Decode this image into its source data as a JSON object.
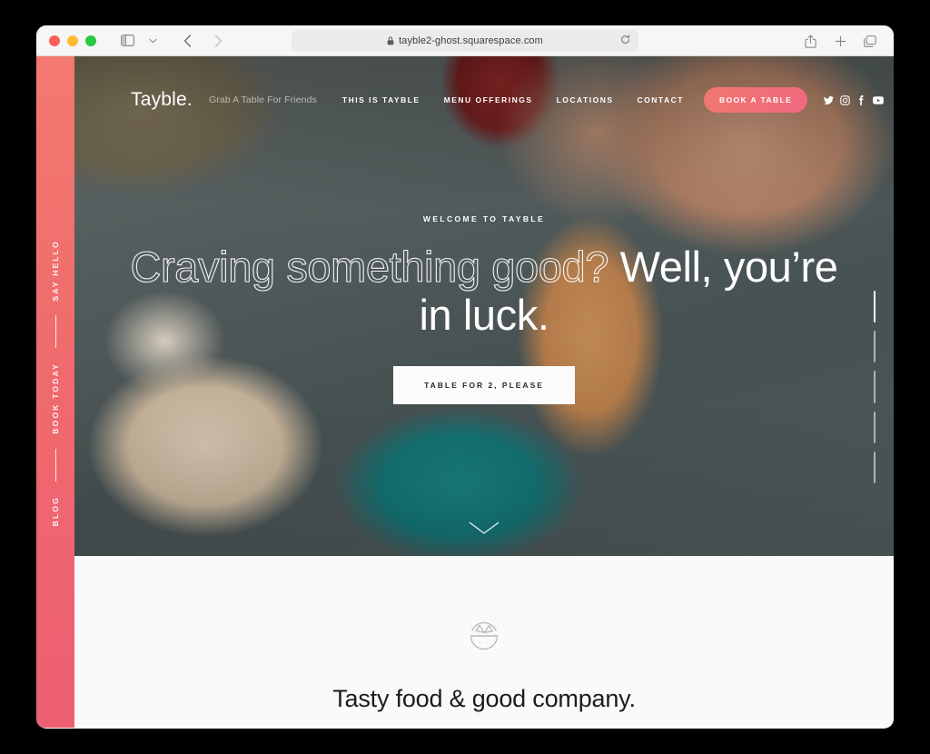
{
  "browser": {
    "traffic_lights": [
      "close",
      "minimize",
      "maximize"
    ],
    "sidebar_toggle_label": "Show Sidebar",
    "tab_overview_label": "Tab Overview",
    "back_label": "Back",
    "forward_label": "Forward",
    "url": "tayble2-ghost.squarespace.com",
    "lock_icon": "lock-icon",
    "reload_icon": "reload-icon",
    "share_icon": "share-icon",
    "new_tab_icon": "plus-icon",
    "tabs_icon": "tabs-icon"
  },
  "side_rail": {
    "links": [
      {
        "label": "SAY HELLO"
      },
      {
        "label": "BOOK TODAY"
      },
      {
        "label": "BLOG"
      }
    ],
    "color_top": "#f4796f",
    "color_bottom": "#ed5f72"
  },
  "nav": {
    "brand": "Tayble.",
    "tagline": "Grab A Table For Friends",
    "links": [
      {
        "label": "THIS IS TAYBLE"
      },
      {
        "label": "MENU OFFERINGS"
      },
      {
        "label": "LOCATIONS"
      },
      {
        "label": "CONTACT"
      }
    ],
    "cta_label": "BOOK A TABLE",
    "cta_color": "#f1697f",
    "social": [
      {
        "name": "twitter-icon"
      },
      {
        "name": "instagram-icon"
      },
      {
        "name": "facebook-icon"
      },
      {
        "name": "youtube-icon"
      }
    ]
  },
  "hero": {
    "eyebrow": "WELCOME TO TAYBLE",
    "headline_outline": "Craving something good?",
    "headline_solid": " Well, you’re in luck.",
    "cta_label": "TABLE FOR 2, PLEASE",
    "scroll_hint_icon": "chevron-down-icon"
  },
  "scroll_progress": {
    "segments": 5,
    "active_index": 0
  },
  "section_two": {
    "icon": "salsa-bowl-icon",
    "title": "Tasty food & good company."
  }
}
